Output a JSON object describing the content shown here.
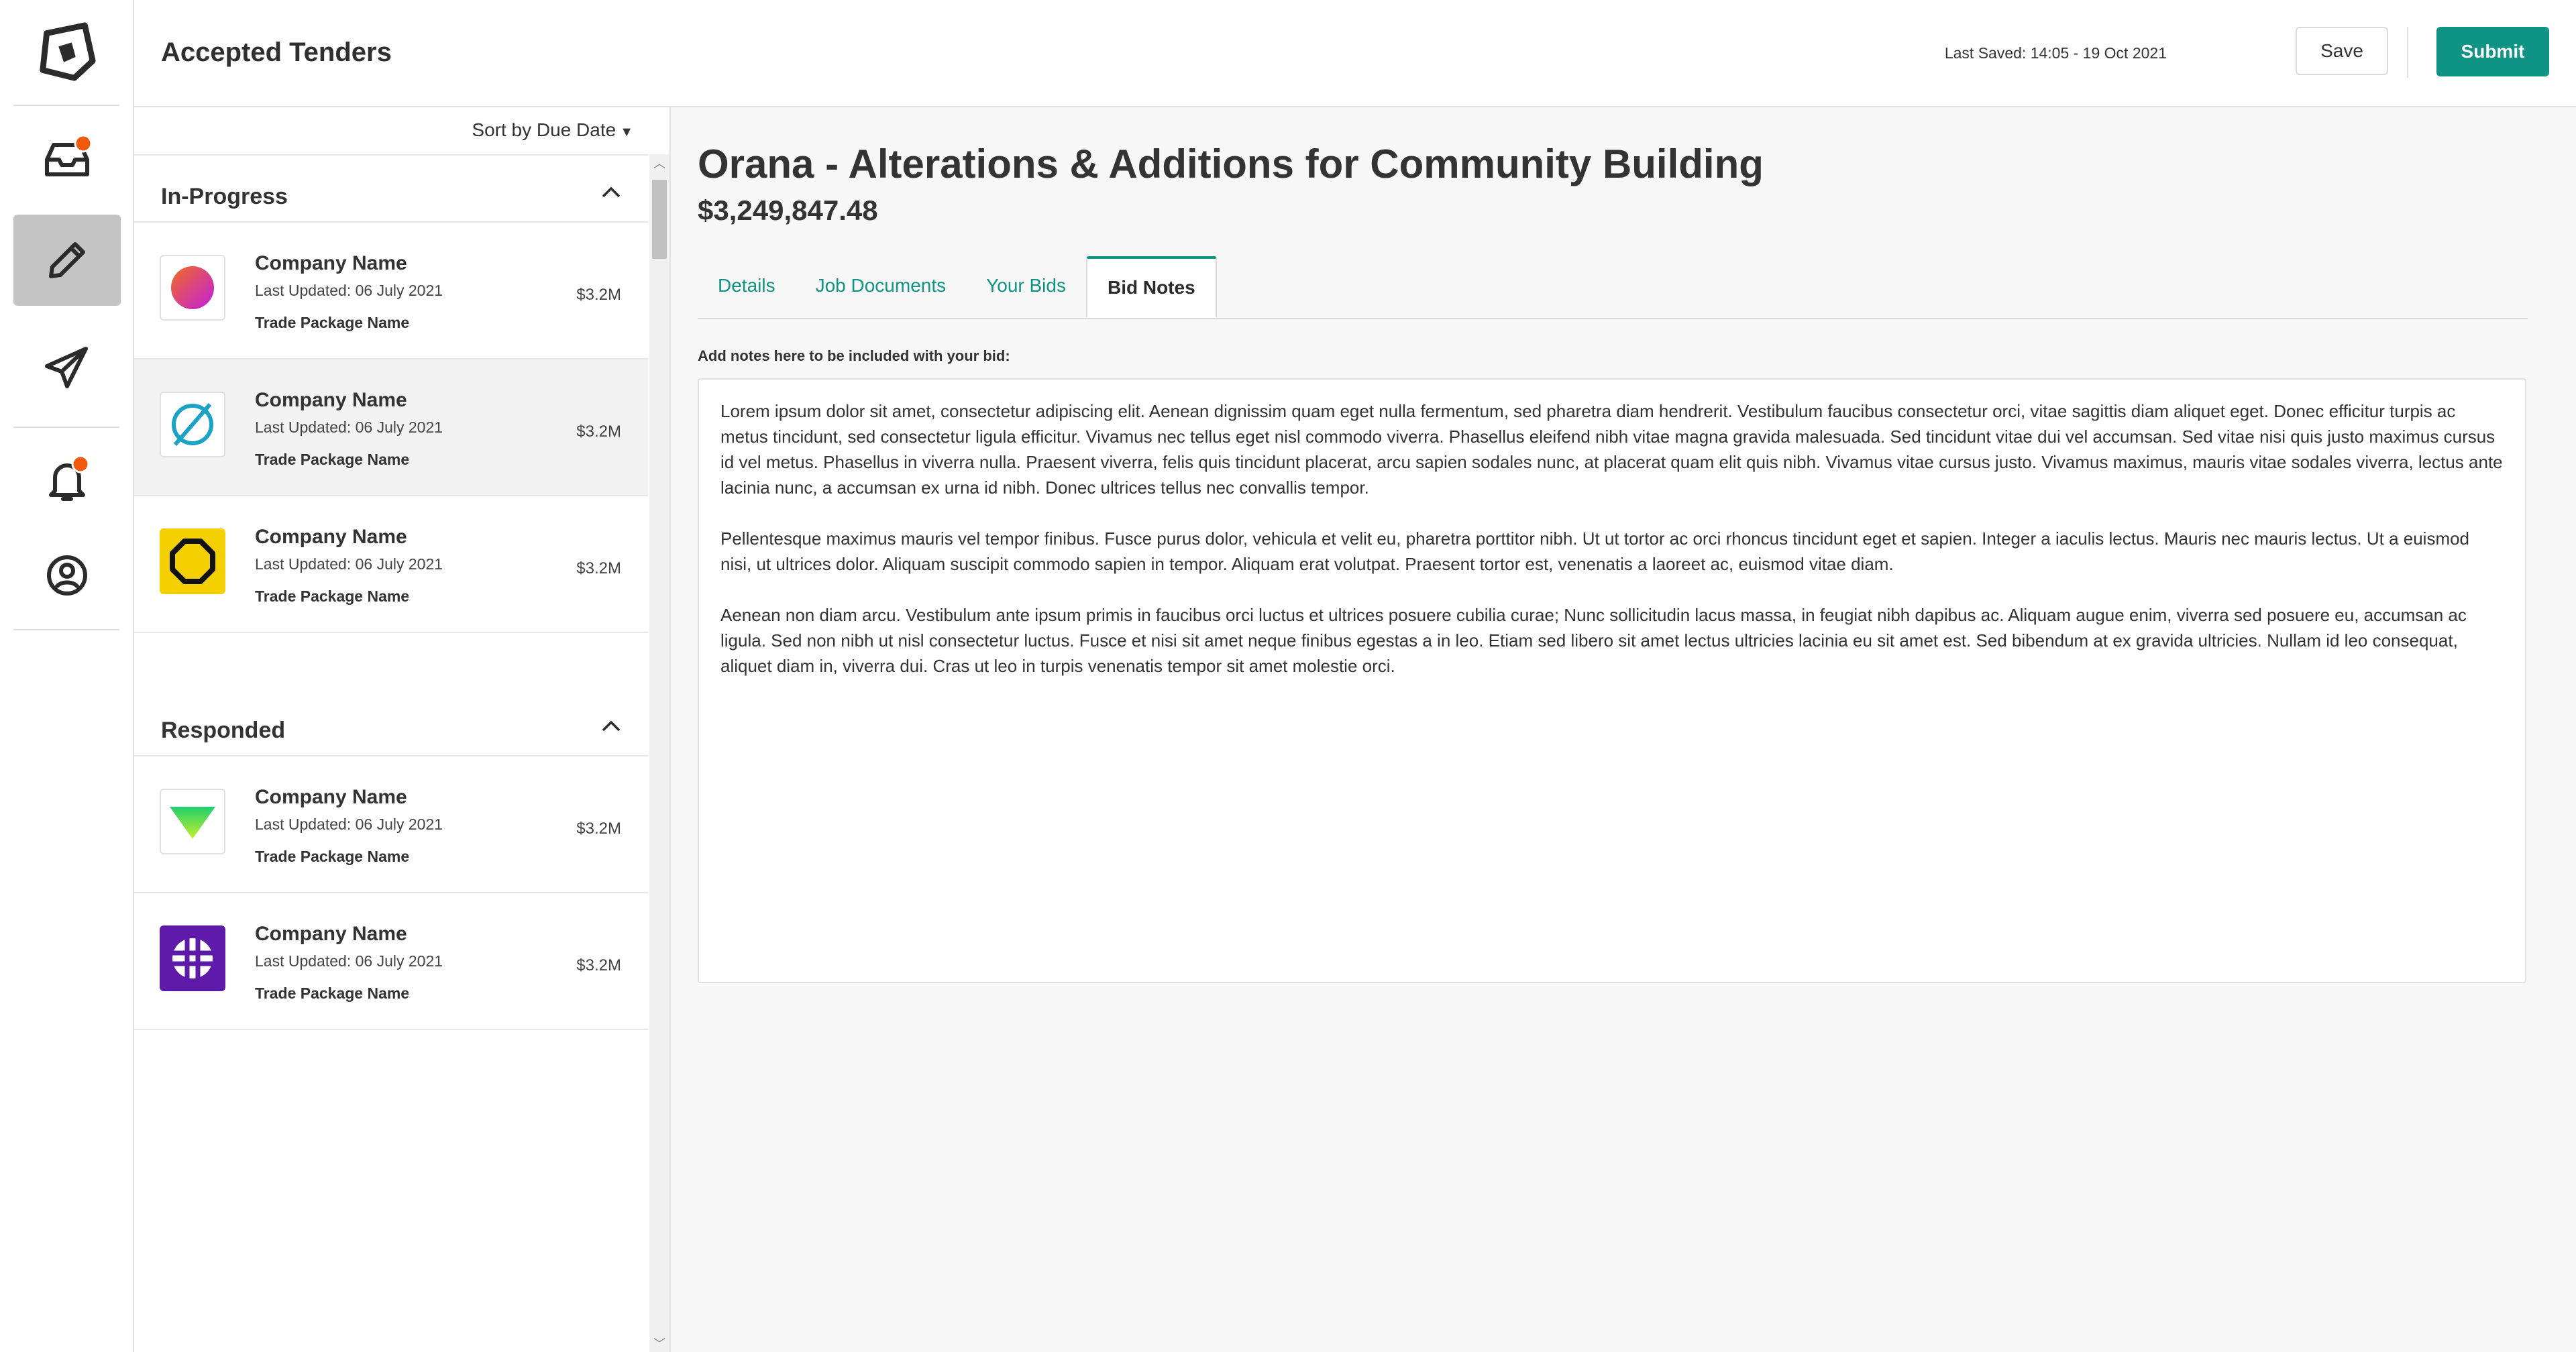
{
  "app": {
    "page_title": "Accepted Tenders",
    "nav": [
      {
        "name": "inbox",
        "icon": "inbox-icon",
        "has_badge": true
      },
      {
        "name": "tenders",
        "icon": "pencil-icon",
        "active": true
      },
      {
        "name": "sent",
        "icon": "paper-plane-icon"
      },
      {
        "name": "notifications",
        "icon": "bell-icon",
        "has_badge": true
      },
      {
        "name": "profile",
        "icon": "user-circle-icon"
      }
    ],
    "badge_color": "#f15a0d",
    "accent_color": "#0f9384"
  },
  "header": {
    "last_saved": "Last Saved: 14:05 - 19 Oct 2021",
    "save_label": "Save",
    "submit_label": "Submit"
  },
  "list": {
    "sort_label": "Sort by Due Date",
    "groups": [
      {
        "title": "In-Progress",
        "items": [
          {
            "company": "Company Name",
            "updated": "Last Updated: 06 July 2021",
            "package": "Trade Package Name",
            "price": "$3.2M",
            "logo": "gradient-circle-logo"
          },
          {
            "company": "Company Name",
            "updated": "Last Updated: 06 July 2021",
            "package": "Trade Package Name",
            "price": "$3.2M",
            "logo": "slashed-circle-logo"
          },
          {
            "company": "Company Name",
            "updated": "Last Updated: 06 July 2021",
            "package": "Trade Package Name",
            "price": "$3.2M",
            "logo": "octagon-logo"
          }
        ]
      },
      {
        "title": "Responded",
        "items": [
          {
            "company": "Company Name",
            "updated": "Last Updated: 06 July 2021",
            "package": "Trade Package Name",
            "price": "$3.2M",
            "logo": "triangle-logo"
          },
          {
            "company": "Company Name",
            "updated": "Last Updated: 06 July 2021",
            "package": "Trade Package Name",
            "price": "$3.2M",
            "logo": "grid-circle-logo"
          }
        ]
      }
    ]
  },
  "detail": {
    "title": "Orana - Alterations & Additions for Community Building",
    "value": "$3,249,847.48",
    "tabs": [
      "Details",
      "Job Documents",
      "Your Bids",
      "Bid Notes"
    ],
    "active_tab": "Bid Notes",
    "notes_label": "Add notes here to be included with your bid:",
    "notes": [
      "Lorem ipsum dolor sit amet, consectetur adipiscing elit. Aenean dignissim quam eget nulla fermentum, sed pharetra diam hendrerit. Vestibulum faucibus consectetur orci, vitae sagittis diam aliquet eget. Donec efficitur turpis ac metus tincidunt, sed consectetur ligula efficitur. Vivamus nec tellus eget nisl commodo viverra. Phasellus eleifend nibh vitae magna gravida malesuada. Sed tincidunt vitae dui vel accumsan. Sed vitae nisi quis justo maximus cursus id vel metus. Phasellus in viverra nulla. Praesent viverra, felis quis tincidunt placerat, arcu sapien sodales nunc, at placerat quam elit quis nibh. Vivamus vitae cursus justo. Vivamus maximus, mauris vitae sodales viverra, lectus ante lacinia nunc, a accumsan ex urna id nibh. Donec ultrices tellus nec convallis tempor.",
      "Pellentesque maximus mauris vel tempor finibus. Fusce purus dolor, vehicula et velit eu, pharetra porttitor nibh. Ut ut tortor ac orci rhoncus tincidunt eget et sapien. Integer a iaculis lectus. Mauris nec mauris lectus. Ut a euismod nisi, ut ultrices dolor. Aliquam suscipit commodo sapien in tempor. Aliquam erat volutpat. Praesent tortor est, venenatis a laoreet ac, euismod vitae diam.",
      "Aenean non diam arcu. Vestibulum ante ipsum primis in faucibus orci luctus et ultrices posuere cubilia curae; Nunc sollicitudin lacus massa, in feugiat nibh dapibus ac. Aliquam augue enim, viverra sed posuere eu, accumsan ac ligula. Sed non nibh ut nisl consectetur luctus. Fusce et nisi sit amet neque finibus egestas a in leo. Etiam sed libero sit amet lectus ultricies lacinia eu sit amet est. Sed bibendum at ex gravida ultricies. Nullam id leo consequat, aliquet diam in, viverra dui. Cras ut leo in turpis venenatis tempor sit amet molestie orci."
    ]
  }
}
